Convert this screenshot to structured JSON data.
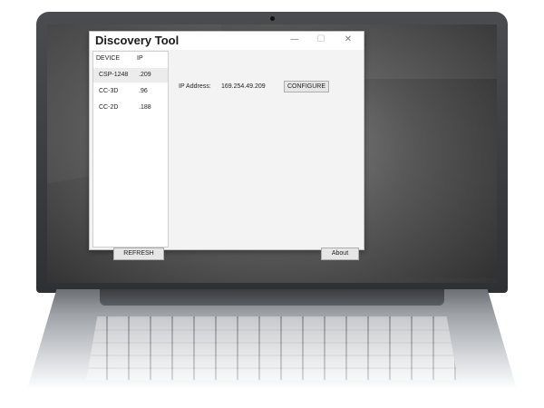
{
  "window": {
    "title": "Discovery Tool",
    "minimize_glyph": "—",
    "maximize_glyph": "☐",
    "close_glyph": "✕"
  },
  "device_list": {
    "columns": [
      "DEVICE",
      "IP"
    ],
    "rows": [
      {
        "device": "CSP-1248",
        "ip": ".209",
        "selected": true
      },
      {
        "device": "CC-3D",
        "ip": ".96",
        "selected": false
      },
      {
        "device": "CC-2D",
        "ip": ".188",
        "selected": false
      }
    ],
    "refresh_label": "REFRESH"
  },
  "details": {
    "ip_label": "IP Address:",
    "ip_value": "169.254.49.209",
    "configure_label": "CONFIGURE"
  },
  "footer": {
    "about_label": "About"
  },
  "icons": {
    "minimize": "minimize-icon",
    "maximize": "maximize-icon",
    "close": "close-icon"
  }
}
